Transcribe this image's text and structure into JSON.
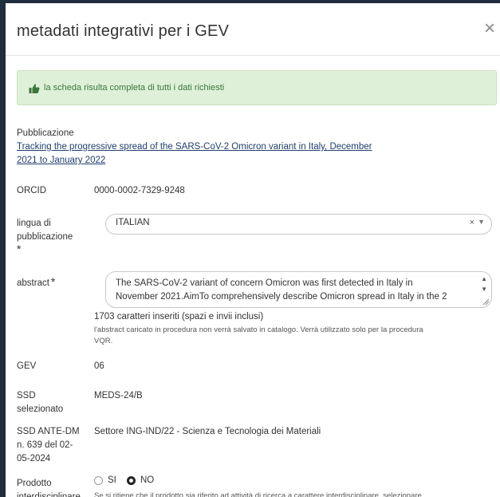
{
  "modal": {
    "title": "metadati integrativi per i GEV",
    "close_symbol": "×"
  },
  "alert": {
    "icon": "thumbs-up-icon",
    "text": "la scheda risulta completa di tutti i dati richiesti",
    "color": "#3c763d",
    "background": "#dff0d8"
  },
  "publication": {
    "label": "Pubblicazione",
    "title_line1": "Tracking the progressive spread of the SARS-CoV-2 Omicron variant in Italy, December",
    "title_line2": "2021 to January 2022"
  },
  "orcid": {
    "label": "ORCID",
    "value": "0000-0002-7329-9248"
  },
  "language": {
    "label_line1": "lingua di",
    "label_line2": "pubblicazione",
    "required": "*",
    "selected": "ITALIAN",
    "clear": "×",
    "caret": "▼"
  },
  "abstract": {
    "label": "abstract",
    "required": "*",
    "text_line1": "The SARS-CoV-2 variant of concern Omicron was first detected in Italy in",
    "text_line2": "November 2021.AimTo comprehensively describe Omicron spread in Italy in the 2",
    "char_count": "1703 caratteri inseriti (spazi e invii inclusi)",
    "note_line1": "l'abstract caricato in procedura non verrà salvato in catalogo. Verrà utilizzato solo per la procedura",
    "note_line2": "VQR."
  },
  "gev": {
    "label": "GEV",
    "value": "06"
  },
  "ssd": {
    "label_line1": "SSD",
    "label_line2": "selezionato",
    "value": "MEDS-24/B"
  },
  "ssd_ante": {
    "label_line1": "SSD ANTE-DM",
    "label_line2": "n. 639 del 02-",
    "label_line3": "05-2024",
    "value": "Settore ING-IND/22 - Scienza e Tecnologia dei Materiali"
  },
  "prodotto": {
    "label_line1": "Prodotto",
    "label_line2": "interdisciplinare",
    "options": [
      "SI",
      "NO"
    ],
    "selected": "NO",
    "hint": "Se si ritiene che il prodotto sia riferito ad attività di ricerca a carattere interdisciplinare, selezionare"
  }
}
